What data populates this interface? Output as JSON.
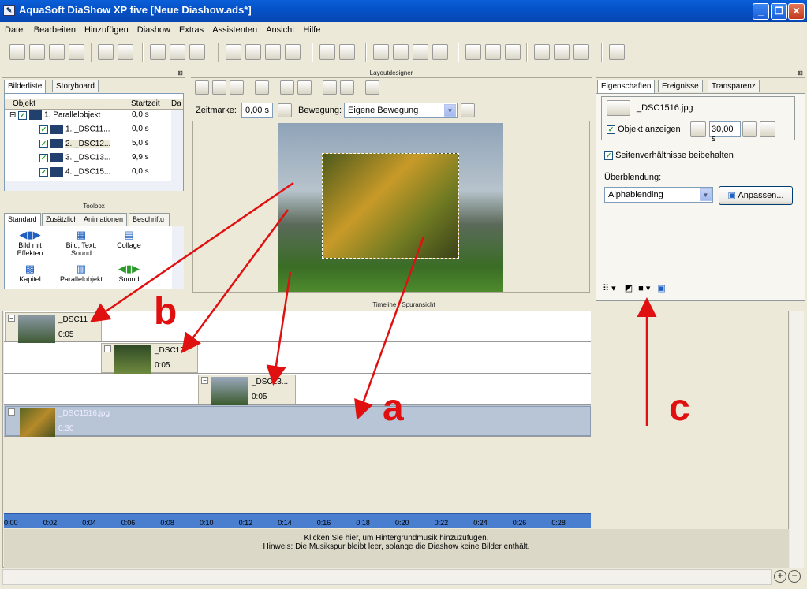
{
  "window": {
    "title": "AquaSoft DiaShow XP five [Neue Diashow.ads*]",
    "minimize": "_",
    "maximize": "❐",
    "close": "✕"
  },
  "menu": [
    "Datei",
    "Bearbeiten",
    "Hinzufügen",
    "Diashow",
    "Extras",
    "Assistenten",
    "Ansicht",
    "Hilfe"
  ],
  "bilderliste": {
    "tabs": [
      "Bilderliste",
      "Storyboard"
    ],
    "columns": [
      "Objekt",
      "Startzeit",
      "Da"
    ],
    "rows": [
      {
        "name": "1. Parallelobjekt",
        "time": "0,0 s"
      },
      {
        "name": "1. _DSC11...",
        "time": "0,0 s"
      },
      {
        "name": "2. _DSC12...",
        "time": "5,0 s"
      },
      {
        "name": "3. _DSC13...",
        "time": "9,9 s"
      },
      {
        "name": "4. _DSC15...",
        "time": "0,0 s"
      }
    ]
  },
  "toolbox": {
    "title": "Toolbox",
    "tabs": [
      "Standard",
      "Zusätzlich",
      "Animationen",
      "Beschriftu"
    ],
    "items": [
      {
        "label": "Bild mit Effekten"
      },
      {
        "label": "Bild, Text, Sound"
      },
      {
        "label": "Collage"
      },
      {
        "label": "Kapitel"
      },
      {
        "label": "Parallelobjekt"
      },
      {
        "label": "Sound"
      }
    ]
  },
  "layout": {
    "title": "Layoutdesigner",
    "zeitmarke_label": "Zeitmarke:",
    "zeitmarke_value": "0,00 s",
    "bewegung_label": "Bewegung:",
    "bewegung_value": "Eigene Bewegung"
  },
  "props": {
    "tabs": [
      "Eigenschaften",
      "Ereignisse",
      "Transparenz"
    ],
    "file": "_DSC1516.jpg",
    "show_label": "Objekt anzeigen",
    "duration": "30,00 s",
    "aspect_label": "Seitenverhältnisse beibehalten",
    "blend_label": "Überblendung:",
    "blend_value": "Alphablending",
    "adjust_label": "Anpassen..."
  },
  "timeline": {
    "title": "Timeline - Spuransicht",
    "clips": [
      {
        "title": "_DSC11",
        "time": "0:05"
      },
      {
        "title": "_DSC12...",
        "time": "0:05"
      },
      {
        "title": "_DSC13...",
        "time": "0:05"
      },
      {
        "title": "_DSC1516.jpg",
        "time": "0:30"
      }
    ],
    "ruler": [
      "0:00",
      "0:02",
      "0:04",
      "0:06",
      "0:08",
      "0:10",
      "0:12",
      "0:14",
      "0:16",
      "0:18",
      "0:20",
      "0:22",
      "0:24",
      "0:26",
      "0:28"
    ],
    "music_hint": "Klicken Sie hier, um Hintergrundmusik hinzuzufügen.",
    "music_note": "Hinweis: Die Musikspur bleibt leer, solange die Diashow keine Bilder enthält."
  },
  "annotations": {
    "a": "a",
    "b": "b",
    "c": "c"
  },
  "colors": {
    "annotation": "#e01010",
    "titlebar": "#0552c9"
  }
}
